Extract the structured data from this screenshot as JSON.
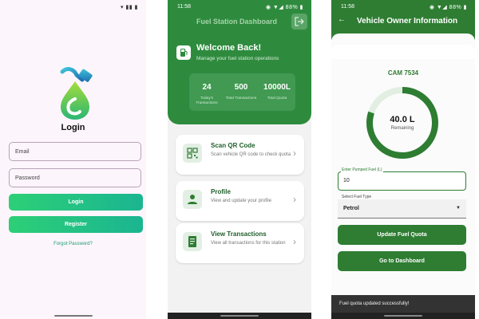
{
  "screen1": {
    "status": {
      "time": "",
      "icons": "▾ ▮▮ ▮"
    },
    "title": "Login",
    "email_placeholder": "Email",
    "password_placeholder": "Password",
    "login_label": "Login",
    "register_label": "Register",
    "forgot_label": "Forgot Password?",
    "colors": {
      "background": "#fcf5fb",
      "accent": "#1ab591"
    }
  },
  "screen2": {
    "status": {
      "time": "11:58",
      "icons": "◉ ▼◢ 88% ▮"
    },
    "header_title": "Fuel Station Dashboard",
    "welcome_title": "Welcome Back!",
    "welcome_subtitle": "Manage your fuel station operations",
    "stats": [
      {
        "value": "24",
        "label": "Today's Transactions"
      },
      {
        "value": "500",
        "label": "Total Transactions"
      },
      {
        "value": "10000L",
        "label": "Total Quota"
      }
    ],
    "cards": [
      {
        "title": "Scan QR Code",
        "desc": "Scan vehicle QR code to check quota",
        "icon": "qr-code-icon"
      },
      {
        "title": "Profile",
        "desc": "View and update your profile",
        "icon": "person-icon"
      },
      {
        "title": "View Transactions",
        "desc": "View all transactions for this station",
        "icon": "receipt-icon"
      }
    ],
    "colors": {
      "primary": "#2e8b3e"
    }
  },
  "screen3": {
    "status": {
      "time": "11:58",
      "icons": "◉ ▼◢ 88% ▮"
    },
    "header_title": "Vehicle Owner Information",
    "vehicle_plate": "CAM 7534",
    "remaining_value": "40.0 L",
    "remaining_label": "Remaining",
    "remaining_fraction": 0.8,
    "fuel_input_label": "Enter Pumped Fuel (L)",
    "fuel_input_value": "10",
    "fuel_type_label": "Select Fuel Type",
    "fuel_type_value": "Petrol",
    "update_button": "Update Fuel Quota",
    "dashboard_button": "Go to Dashboard",
    "snackbar": "Fuel quota updated successfully!",
    "colors": {
      "primary": "#2e7d32"
    }
  }
}
